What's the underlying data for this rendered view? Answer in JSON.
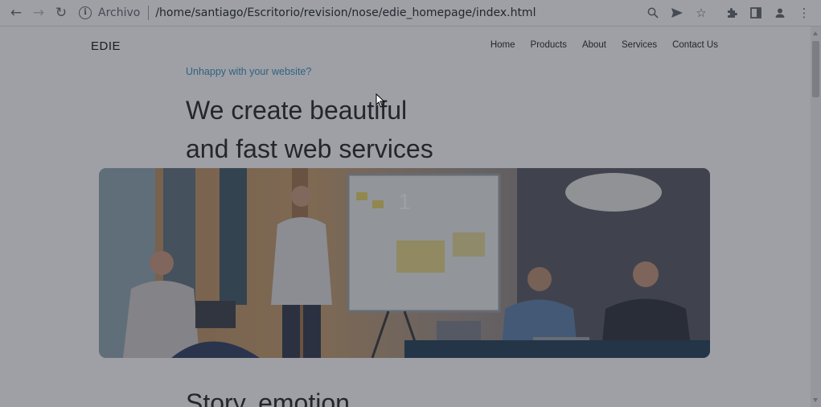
{
  "browser": {
    "scheme_label": "Archivo",
    "url": "/home/santiago/Escritorio/revision/nose/edie_homepage/index.html",
    "icons": [
      "back-icon",
      "forward-icon",
      "reload-icon",
      "info-icon",
      "zoom-icon",
      "send-icon",
      "star-icon",
      "extensions-icon",
      "sidebar-icon",
      "profile-icon",
      "menu-icon"
    ]
  },
  "site": {
    "logo": "EDIE",
    "nav": [
      {
        "label": "Home"
      },
      {
        "label": "Products"
      },
      {
        "label": "About"
      },
      {
        "label": "Services"
      },
      {
        "label": "Contact Us"
      }
    ],
    "eyebrow": "Unhappy with your website?",
    "headline_line1": "We create beautiful",
    "headline_line2": "and fast web services",
    "slide_number": "1",
    "next_section_title": "Story, emotion"
  },
  "colors": {
    "eyebrow": "#3a8fb7",
    "overlay": "rgba(40,44,58,0.45)"
  }
}
